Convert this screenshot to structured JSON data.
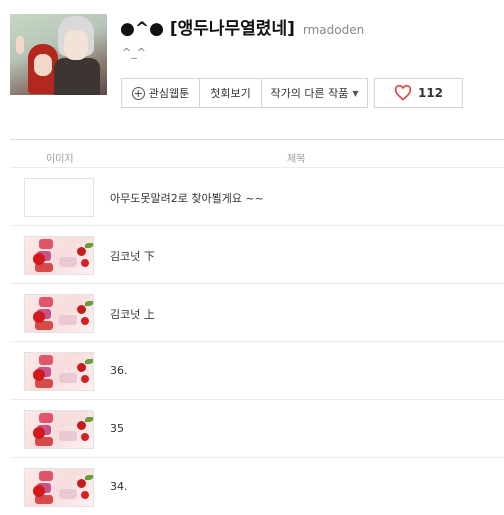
{
  "header": {
    "title": "●^● [앵두나무열렸네]",
    "author": "rmadoden",
    "description": "^_^"
  },
  "actions": {
    "interest": "관심웹툰",
    "first_episode": "첫회보기",
    "other_works": "작가의 다른 작품",
    "like_count": "112"
  },
  "table": {
    "col_image": "이미지",
    "col_title": "제목",
    "rows": [
      {
        "title": "아무도못말려2로 찾아뵐게요 ~~",
        "thumb": "blank"
      },
      {
        "title": "김코넛 下",
        "thumb": "cherry"
      },
      {
        "title": "김코넛 上",
        "thumb": "cherry"
      },
      {
        "title": "36.",
        "thumb": "cherry"
      },
      {
        "title": "35",
        "thumb": "cherry"
      },
      {
        "title": "34.",
        "thumb": "cherry"
      }
    ]
  },
  "colors": {
    "heart": "#e0403a",
    "text": "#333333",
    "border": "#d4d4d4"
  },
  "icons": {
    "interest": "plus-circle-icon",
    "dropdown": "caret-down-icon",
    "like": "heart-icon"
  }
}
